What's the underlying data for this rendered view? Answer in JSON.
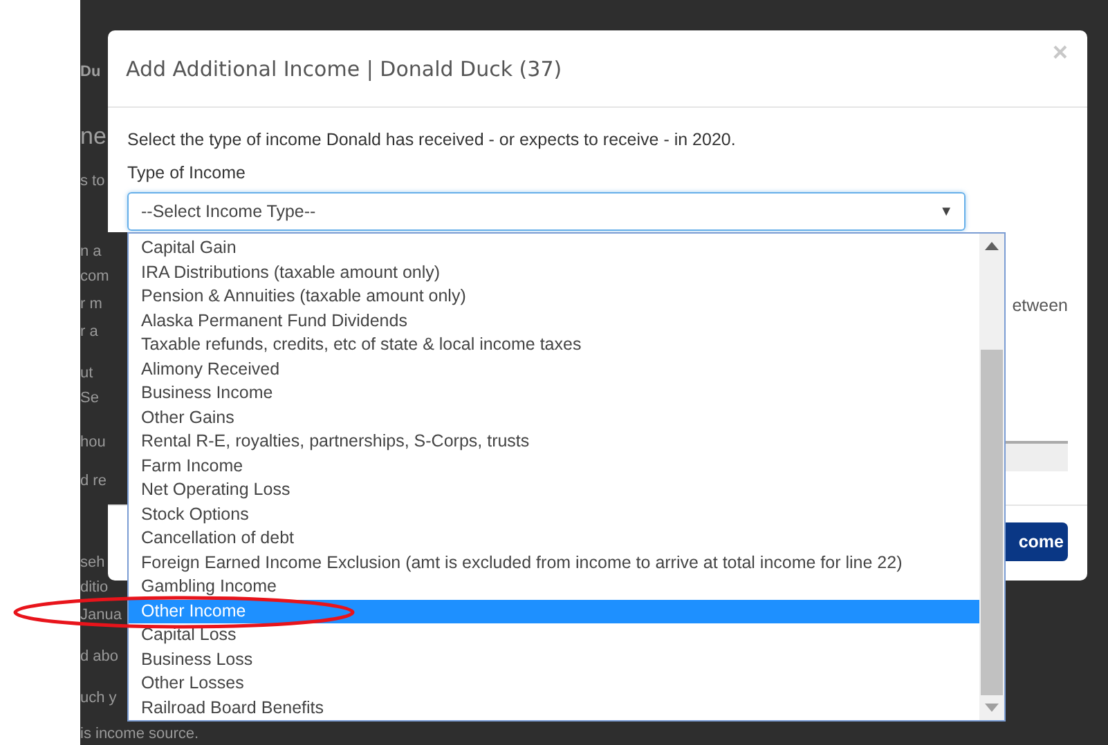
{
  "background_page": {
    "fragments": [
      {
        "text": "Du",
        "kind": "tab"
      },
      {
        "text": "ne",
        "kind": "heading"
      },
      {
        "text": "s to",
        "kind": "text"
      },
      {
        "text": "n a",
        "kind": "text"
      },
      {
        "text": "com",
        "kind": "text"
      },
      {
        "text": "r m",
        "kind": "text"
      },
      {
        "text": "r a",
        "kind": "text"
      },
      {
        "text": "ut",
        "kind": "text"
      },
      {
        "text": "Se",
        "kind": "text"
      },
      {
        "text": "hou",
        "kind": "text"
      },
      {
        "text": "d re",
        "kind": "text"
      },
      {
        "text": "seh",
        "kind": "text"
      },
      {
        "text": "ditio",
        "kind": "text"
      },
      {
        "text": "Janua",
        "kind": "text"
      },
      {
        "text": "d abo",
        "kind": "text"
      },
      {
        "text": "uch y",
        "kind": "text"
      },
      {
        "text": "is income source.",
        "kind": "text"
      }
    ]
  },
  "modal": {
    "title": "Add Additional Income | Donald Duck (37)",
    "close": "×",
    "instruction": "Select the type of income Donald has received - or expects to receive - in 2020.",
    "field_label": "Type of Income",
    "select": {
      "value": "--Select Income Type--",
      "caret": "▼",
      "options": [
        {
          "label": "Capital Gain",
          "selected": false
        },
        {
          "label": "IRA Distributions (taxable amount only)",
          "selected": false
        },
        {
          "label": "Pension & Annuities (taxable amount only)",
          "selected": false
        },
        {
          "label": "Alaska Permanent Fund Dividends",
          "selected": false
        },
        {
          "label": "Taxable refunds, credits, etc of state & local income taxes",
          "selected": false
        },
        {
          "label": "Alimony Received",
          "selected": false
        },
        {
          "label": "Business Income",
          "selected": false
        },
        {
          "label": "Other Gains",
          "selected": false
        },
        {
          "label": "Rental R-E, royalties, partnerships, S-Corps, trusts",
          "selected": false
        },
        {
          "label": "Farm Income",
          "selected": false
        },
        {
          "label": "Net Operating Loss",
          "selected": false
        },
        {
          "label": "Stock Options",
          "selected": false
        },
        {
          "label": "Cancellation of debt",
          "selected": false
        },
        {
          "label": "Foreign Earned Income Exclusion (amt is excluded from income to arrive at total income for line 22)",
          "selected": false
        },
        {
          "label": "Gambling Income",
          "selected": false
        },
        {
          "label": "Other Income",
          "selected": true
        },
        {
          "label": "Capital Loss",
          "selected": false
        },
        {
          "label": "Business Loss",
          "selected": false
        },
        {
          "label": "Other Losses",
          "selected": false
        },
        {
          "label": "Railroad Board Benefits",
          "selected": false
        }
      ]
    },
    "body_fragment": "etween",
    "footer_button": "come"
  }
}
